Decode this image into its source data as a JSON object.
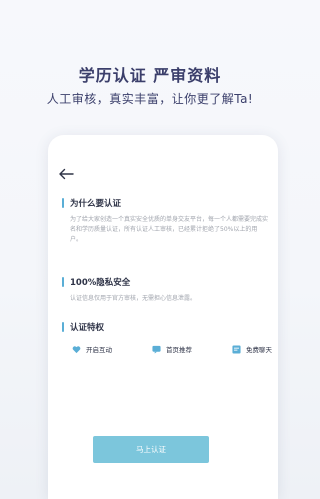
{
  "promo": {
    "headline": "学历认证 严审资料",
    "subline": "人工审核，真实丰富，让你更了解Ta!"
  },
  "screen": {
    "sections": [
      {
        "title": "为什么要认证",
        "desc": "为了给大家创造一个真实安全优质的单身交友平台，每一个人都需要完成实名和学历质量认证，所有认证人工审核，已经累计拒绝了50%以上的用户。"
      },
      {
        "title": "100%隐私安全",
        "desc": "认证信息仅用于官方审核，无需担心信息泄露。"
      },
      {
        "title": "认证特权",
        "desc": ""
      }
    ],
    "privileges": [
      {
        "label": "开启互动",
        "icon": "heart-icon"
      },
      {
        "label": "首页推荐",
        "icon": "recommend-icon"
      },
      {
        "label": "免费聊天",
        "icon": "chat-icon"
      }
    ],
    "cta_label": "马上认证"
  },
  "colors": {
    "accent": "#5aaed6",
    "cta": "#7cc6dc",
    "heading": "#3b3f6b"
  }
}
